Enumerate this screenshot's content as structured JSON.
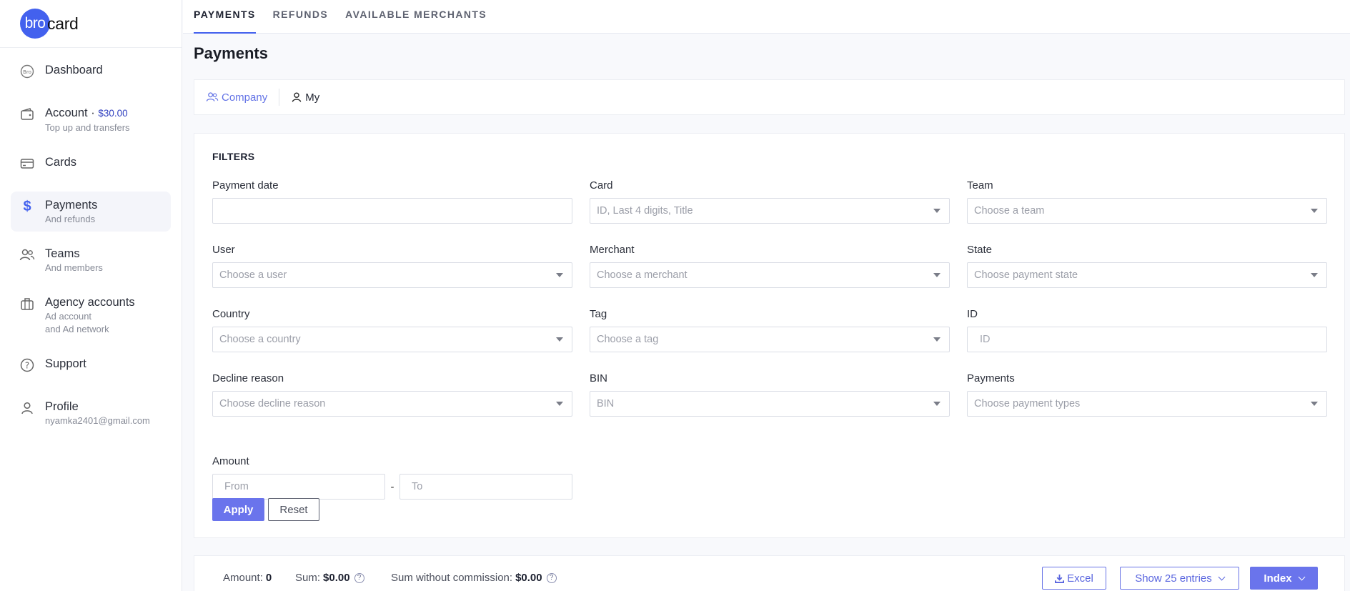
{
  "brand": {
    "logo_mark": "bro",
    "logo_rest": "card"
  },
  "sidebar": {
    "items": [
      {
        "label": "Dashboard",
        "icon": "bro-icon"
      },
      {
        "label": "Account",
        "amount": "$30.00",
        "sub": "Top up and transfers",
        "icon": "wallet-icon"
      },
      {
        "label": "Cards",
        "icon": "card-icon"
      },
      {
        "label": "Payments",
        "sub": "And refunds",
        "icon": "dollar-icon"
      },
      {
        "label": "Teams",
        "sub": "And members",
        "icon": "users-icon"
      },
      {
        "label": "Agency accounts",
        "sub": "Ad account",
        "sub2": "and Ad network",
        "icon": "briefcase-icon"
      },
      {
        "label": "Support",
        "icon": "question-icon"
      },
      {
        "label": "Profile",
        "sub": "nyamka2401@gmail.com",
        "icon": "user-icon"
      }
    ]
  },
  "tabs": [
    "PAYMENTS",
    "REFUNDS",
    "AVAILABLE MERCHANTS"
  ],
  "page": {
    "title": "Payments"
  },
  "scope": {
    "company": "Company",
    "my": "My"
  },
  "filters": {
    "title": "FILTERS",
    "payment_date": {
      "label": "Payment date",
      "placeholder": ""
    },
    "card": {
      "label": "Card",
      "placeholder": "ID, Last 4 digits, Title"
    },
    "team": {
      "label": "Team",
      "placeholder": "Choose a team"
    },
    "user": {
      "label": "User",
      "placeholder": "Choose a user"
    },
    "merchant": {
      "label": "Merchant",
      "placeholder": "Choose a merchant"
    },
    "state": {
      "label": "State",
      "placeholder": "Choose payment state"
    },
    "country": {
      "label": "Country",
      "placeholder": "Choose a country"
    },
    "tag": {
      "label": "Tag",
      "placeholder": "Choose a tag"
    },
    "id": {
      "label": "ID",
      "placeholder": "ID"
    },
    "decline": {
      "label": "Decline reason",
      "placeholder": "Choose decline reason"
    },
    "bin": {
      "label": "BIN",
      "placeholder": "BIN"
    },
    "payments": {
      "label": "Payments",
      "placeholder": "Choose payment types"
    },
    "amount": {
      "label": "Amount",
      "from": "From",
      "to": "To",
      "separator": "-"
    },
    "apply": "Apply",
    "reset": "Reset"
  },
  "summary": {
    "amount_label": "Amount:",
    "amount_value": "0",
    "sum_label": "Sum:",
    "sum_value": "$0.00",
    "sum_wo_label": "Sum without commission:",
    "sum_wo_value": "$0.00",
    "excel": "Excel",
    "show_entries": "Show 25 entries",
    "index": "Index"
  },
  "colors": {
    "accent": "#6a74ec",
    "brand": "#4361ee"
  }
}
